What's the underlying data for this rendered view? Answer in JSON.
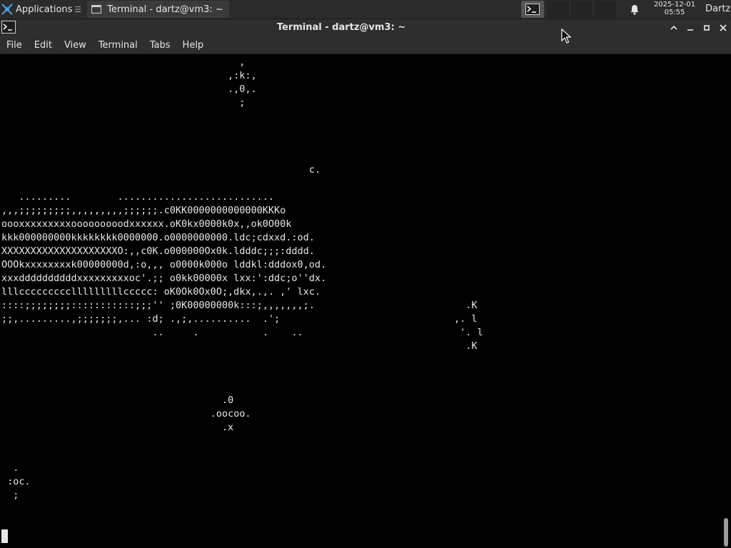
{
  "panel": {
    "applications_label": "Applications",
    "applications_separator": "☰",
    "task_label": "Terminal - dartz@vm3: ~",
    "clock_date": "2025-12-01",
    "clock_time": "05:55",
    "user_label": "Dartz"
  },
  "window": {
    "title": "Terminal - dartz@vm3: ~"
  },
  "menu": {
    "items": [
      "File",
      "Edit",
      "View",
      "Terminal",
      "Tabs",
      "Help"
    ]
  },
  "terminal": {
    "lines": [
      "                                         ,",
      "                                       ,:k:,",
      "                                       .,0,.",
      "                                         ;",
      "",
      "",
      "",
      "                                                     c.",
      "",
      "",
      "   .........        ...........................",
      ",,,;;;;;;;;;,,,,,,,,,;;;;;;.c0KK0000000000000KKKo",
      "oooxxxxxxxxxooooooooodxxxxxx.oK0kx0000k0x,,ok0O00k",
      "kkk000000000kkkkkkkk0000000.o0000000000.ldc;cdxxd.:od.",
      "XXXXXXXXXXXXXXXXXXXXO:,,c0K.o000000Ox0k.ldddc;;;:dddd.",
      "OOOkxxxxxxxxk00000000d,:o,,, o0000k000o lddkl:dddox0,od.",
      "xxxddddddddddxxxxxxxxxoc'.;; o0kk00000x lxx:':ddc;o''dx.",
      "lllccccccccclllllllllccccc: oK0Ok0Ox0O;,dkx,.,. ,' lxc.",
      "::::;;;;;;;;:::::::::::;;;'' ;0K00000000k:::;,,,,,,,;.                          .K",
      ";;,.........,;;;;;;;,... :d; .,;,..........  .';                              ,. l",
      "                          ..     .           .    ..                           '. l",
      "                                                                                .K",
      "",
      "",
      "",
      "                                      .0",
      "                                    .oocoo.",
      "                                      .x",
      "",
      "",
      "  .",
      " :oc.",
      "  ;"
    ]
  }
}
